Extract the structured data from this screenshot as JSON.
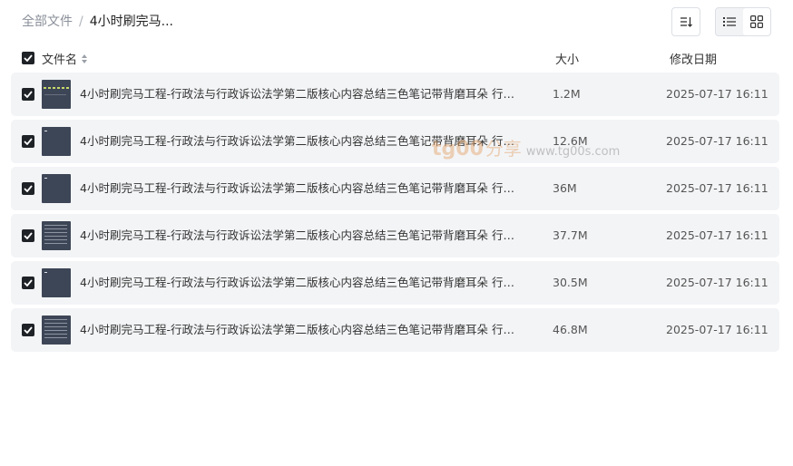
{
  "breadcrumb": {
    "root": "全部文件",
    "separator": "/",
    "current": "4小时刷完马..."
  },
  "toolbar": {
    "sort_icon": "sort-icon",
    "view_list_icon": "list-view-icon",
    "view_grid_icon": "grid-view-icon",
    "active_view": "grid"
  },
  "columns": {
    "name": "文件名",
    "size": "大小",
    "date": "修改日期"
  },
  "select_all_checked": true,
  "files": [
    {
      "name": "4小时刷完马工程-行政法与行政诉讼法学第二版核心内容总结三色笔记带背磨耳朵 行政...",
      "size": "1.2M",
      "date": "2025-07-17 16:11",
      "checked": true,
      "thumb": "t-green"
    },
    {
      "name": "4小时刷完马工程-行政法与行政诉讼法学第二版核心内容总结三色笔记带背磨耳朵 行政...",
      "size": "12.6M",
      "date": "2025-07-17 16:11",
      "checked": true,
      "thumb": "t-dot"
    },
    {
      "name": "4小时刷完马工程-行政法与行政诉讼法学第二版核心内容总结三色笔记带背磨耳朵 行政...",
      "size": "36M",
      "date": "2025-07-17 16:11",
      "checked": true,
      "thumb": "t-dot"
    },
    {
      "name": "4小时刷完马工程-行政法与行政诉讼法学第二版核心内容总结三色笔记带背磨耳朵 行政...",
      "size": "37.7M",
      "date": "2025-07-17 16:11",
      "checked": true,
      "thumb": "t-text"
    },
    {
      "name": "4小时刷完马工程-行政法与行政诉讼法学第二版核心内容总结三色笔记带背磨耳朵 行政...",
      "size": "30.5M",
      "date": "2025-07-17 16:11",
      "checked": true,
      "thumb": "t-dot"
    },
    {
      "name": "4小时刷完马工程-行政法与行政诉讼法学第二版核心内容总结三色笔记带背磨耳朵 行政...",
      "size": "46.8M",
      "date": "2025-07-17 16:11",
      "checked": true,
      "thumb": "t-text"
    }
  ],
  "watermark": {
    "brand": "tg00",
    "share": "分享",
    "url": "www.tg00s.com"
  }
}
